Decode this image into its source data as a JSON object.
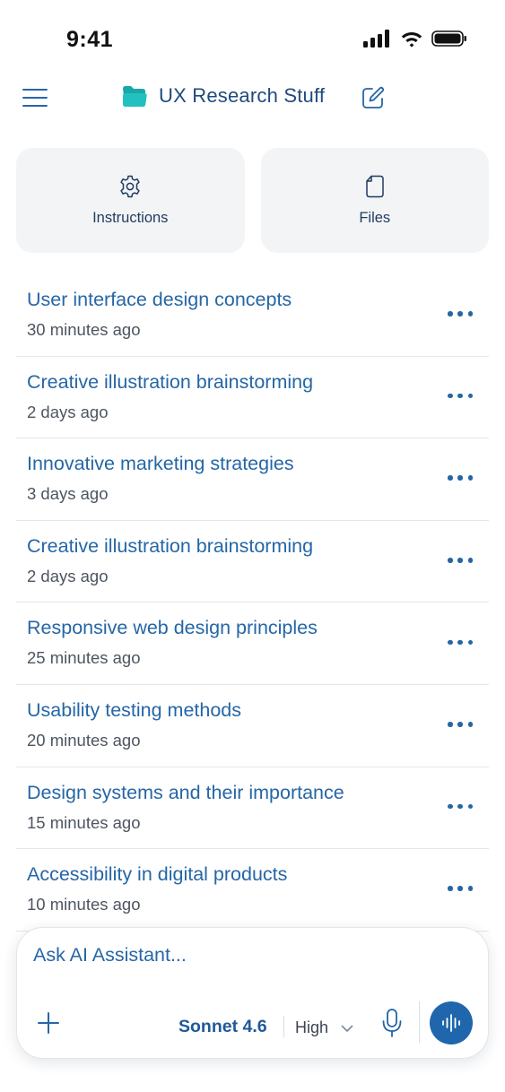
{
  "status_bar": {
    "time": "9:41"
  },
  "header": {
    "title": "UX Research Stuff",
    "icons": [
      "menu-icon",
      "folder-icon",
      "edit-icon"
    ],
    "folder_color": "#1fb3b3"
  },
  "cards": [
    {
      "label": "Instructions",
      "icon": "gear-icon"
    },
    {
      "label": "Files",
      "icon": "file-icon"
    }
  ],
  "chats": [
    {
      "title": "User interface design concepts",
      "time": "30 minutes ago"
    },
    {
      "title": "Creative illustration brainstorming",
      "time": "2 days ago"
    },
    {
      "title": "Innovative marketing strategies",
      "time": "3 days ago"
    },
    {
      "title": "Creative illustration brainstorming",
      "time": "2 days ago"
    },
    {
      "title": "Responsive web design principles",
      "time": "25 minutes ago"
    },
    {
      "title": "Usability testing methods",
      "time": "20 minutes ago"
    },
    {
      "title": "Design systems and their importance",
      "time": "15 minutes ago"
    },
    {
      "title": "Accessibility in digital products",
      "time": "10 minutes ago"
    }
  ],
  "composer": {
    "placeholder": "Ask AI Assistant...",
    "model": "Sonnet 4.6",
    "effort": "High"
  },
  "colors": {
    "accent": "#2566a6",
    "voice_button": "#1f66ad",
    "card_bg": "#f2f4f6"
  }
}
